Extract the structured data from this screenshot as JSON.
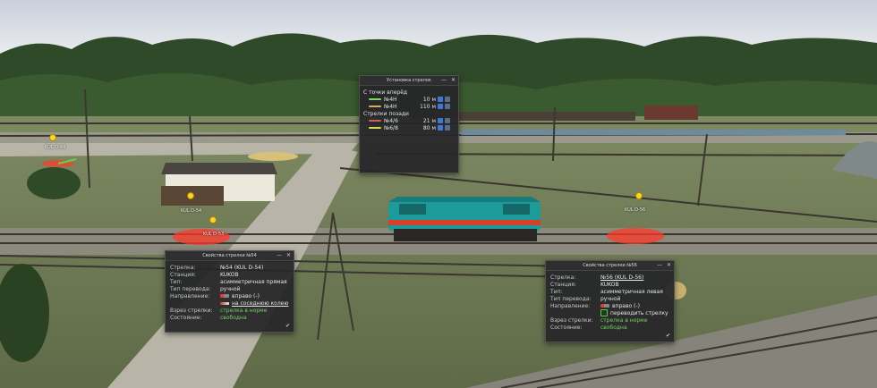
{
  "routes_panel": {
    "title": "Установка стрелок",
    "section_a": "С точки вперёд",
    "section_b": "Стрелки позади",
    "items_a": [
      {
        "name": "№4Н",
        "value": "10 м",
        "color": "#7fd85a"
      },
      {
        "name": "№4Н",
        "value": "110 м",
        "color": "#d8b05a"
      }
    ],
    "items_b": [
      {
        "name": "№4/6",
        "value": "21 м",
        "color": "#d85a5a"
      },
      {
        "name": "№6/8",
        "value": "80 м",
        "color": "#d8d85a"
      }
    ]
  },
  "switch_panel_left": {
    "title": "Свойства стрелки №54",
    "rows": [
      {
        "label": "Стрелка:",
        "value": "№54 (KUL D-54)"
      },
      {
        "label": "Станция:",
        "value": "KUKOB"
      },
      {
        "label": "Тип:",
        "value": "асимметричная прямая"
      },
      {
        "label": "Тип перевода:",
        "value": "ручной"
      },
      {
        "label": "Направление:",
        "value": "вправо (-)"
      },
      {
        "label": "",
        "value": "на соседнюю колею"
      },
      {
        "label": "Взрез стрелки:",
        "value": "стрелка в норме"
      },
      {
        "label": "Состояние:",
        "value": "свободна"
      }
    ]
  },
  "switch_panel_right": {
    "title": "Свойства стрелки №56",
    "rows": [
      {
        "label": "Стрелка:",
        "value": "№56 (KUL D-56)"
      },
      {
        "label": "Станция:",
        "value": "KUKOB"
      },
      {
        "label": "Тип:",
        "value": "асимметричная левая"
      },
      {
        "label": "Тип перевода:",
        "value": "ручной"
      },
      {
        "label": "Направление:",
        "value": "вправо (-)"
      },
      {
        "label": "",
        "value": "переводить стрелку"
      },
      {
        "label": "Взрез стрелки:",
        "value": "стрелка в норме"
      },
      {
        "label": "Состояние:",
        "value": "свободна"
      }
    ]
  },
  "tags": {
    "t1": "KUL D-44",
    "t2": "KUL D-54",
    "t3": "KUL D-53",
    "t4": "KUL D-56"
  },
  "confirm_glyph": "✔",
  "close_glyph": "✕",
  "pin_glyph": "—"
}
